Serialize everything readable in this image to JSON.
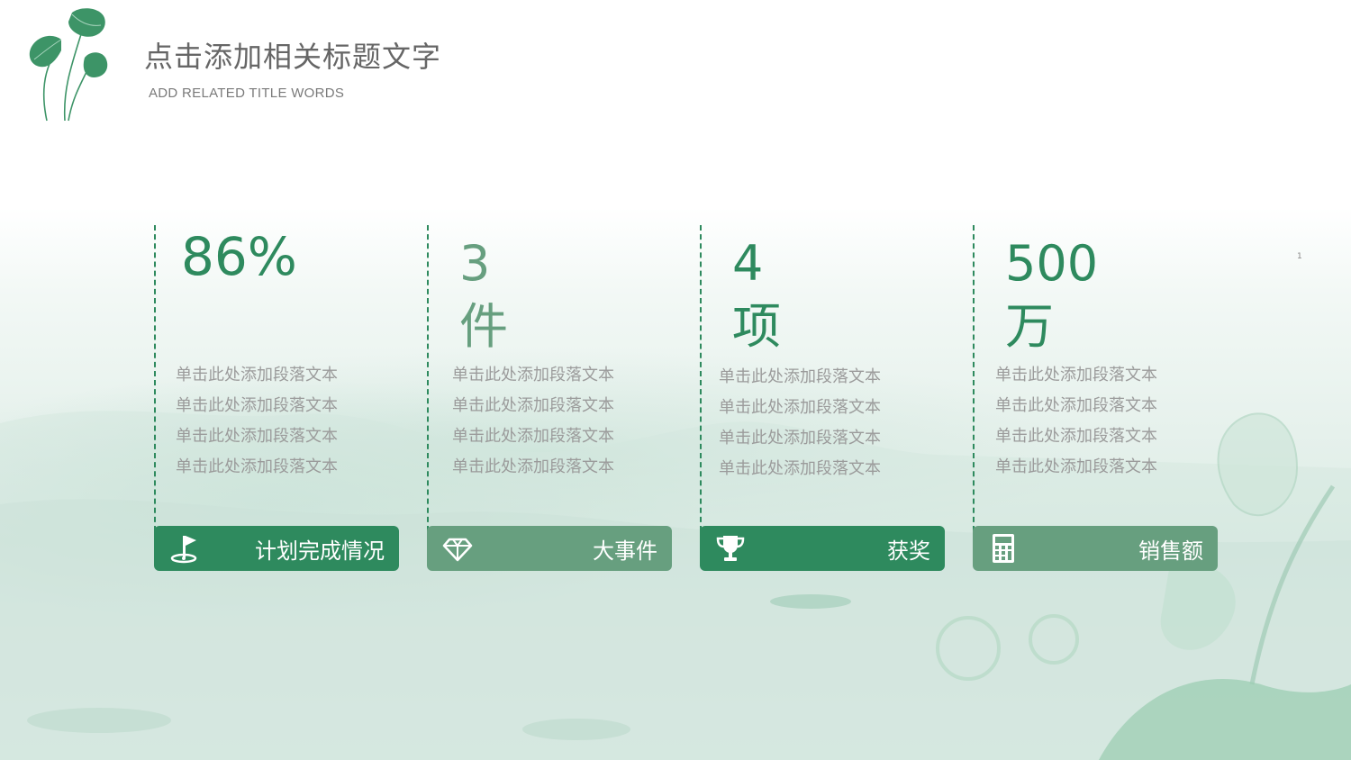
{
  "colors": {
    "accent": "#2e8a5e",
    "accent_light": "#679f7f",
    "text_gray": "#9b9b9b",
    "title_gray": "#666666"
  },
  "header": {
    "title": "点击添加相关标题文字",
    "subtitle": "ADD RELATED TITLE WORDS"
  },
  "marker": "1",
  "columns": [
    {
      "value": "86%",
      "unit": "",
      "paragraphs": [
        "单击此处添加段落文本",
        "单击此处添加段落文本",
        "单击此处添加段落文本",
        "单击此处添加段落文本"
      ],
      "label": "计划完成情况",
      "icon": "flag-icon"
    },
    {
      "value": "3",
      "unit": "件",
      "paragraphs": [
        "单击此处添加段落文本",
        "单击此处添加段落文本",
        "单击此处添加段落文本",
        "单击此处添加段落文本"
      ],
      "label": "大事件",
      "icon": "diamond-icon"
    },
    {
      "value": "4",
      "unit": "项",
      "paragraphs": [
        "单击此处添加段落文本",
        "单击此处添加段落文本",
        "单击此处添加段落文本",
        "单击此处添加段落文本"
      ],
      "label": "获奖",
      "icon": "trophy-icon"
    },
    {
      "value": "500",
      "unit": "万",
      "paragraphs": [
        "单击此处添加段落文本",
        "单击此处添加段落文本",
        "单击此处添加段落文本",
        "单击此处添加段落文本"
      ],
      "label": "销售额",
      "icon": "calculator-icon"
    }
  ]
}
